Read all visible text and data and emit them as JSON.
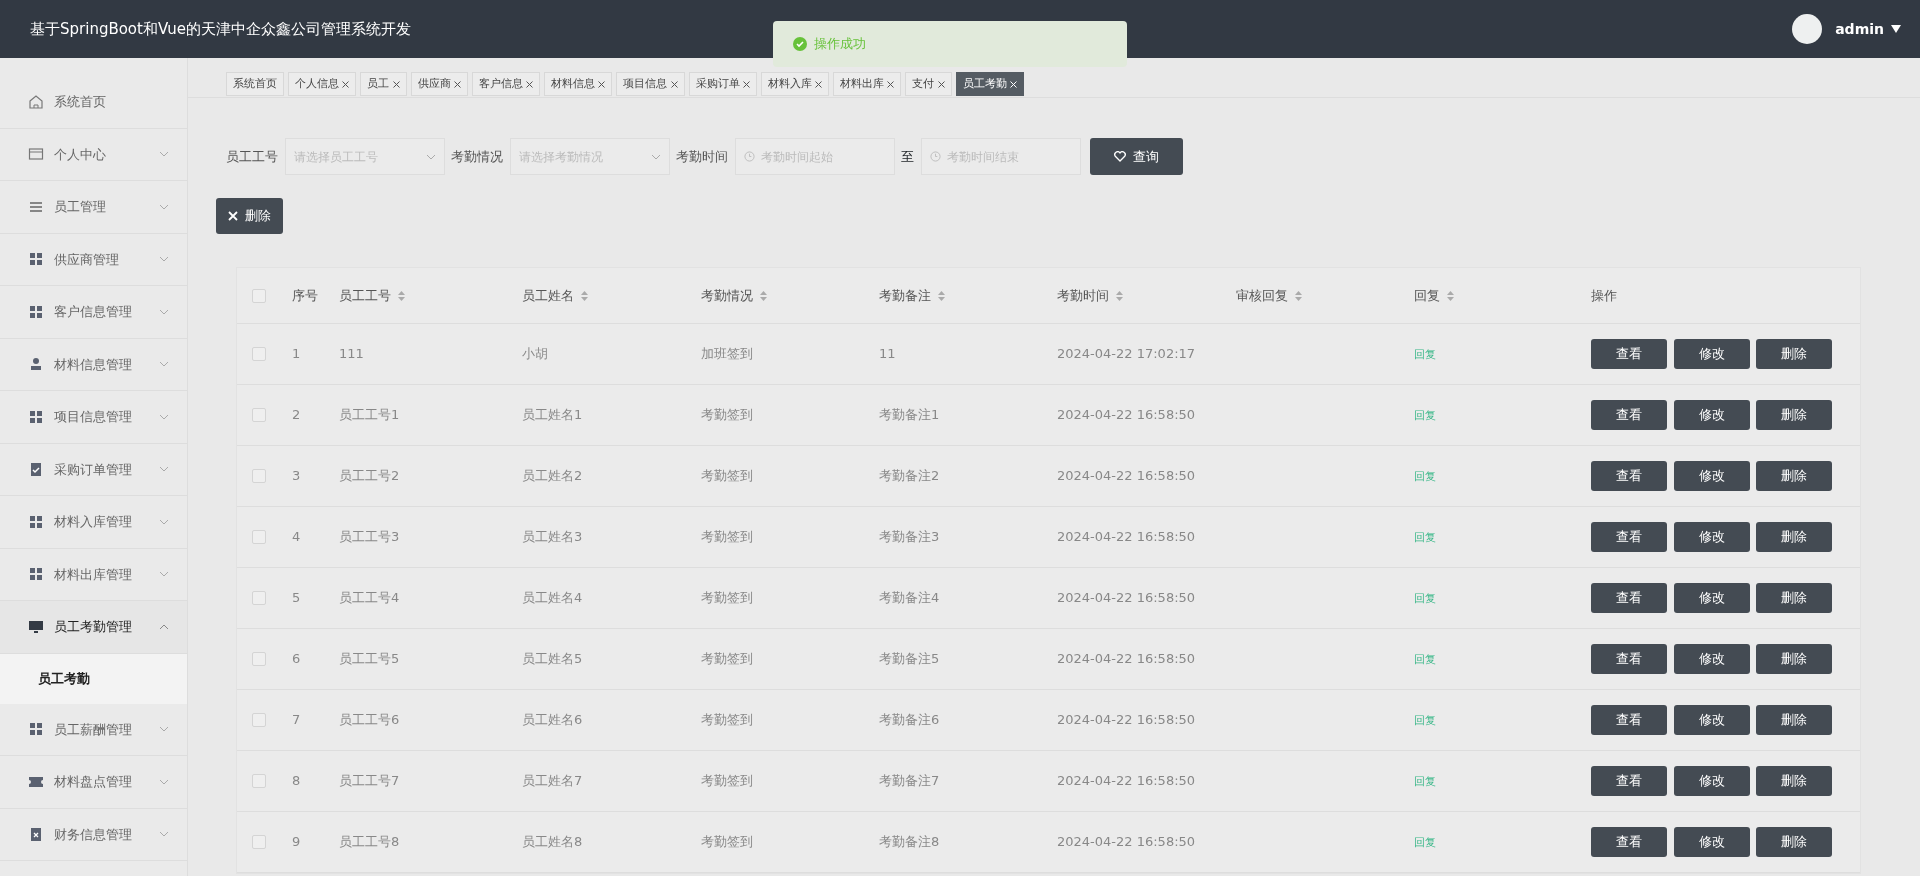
{
  "header": {
    "title": "基于SpringBoot和Vue的天津中企众鑫公司管理系统开发",
    "user": "admin"
  },
  "toast": {
    "text": "操作成功"
  },
  "tabs": [
    {
      "label": "系统首页",
      "closable": false,
      "selected": false
    },
    {
      "label": "个人信息",
      "closable": true,
      "selected": false
    },
    {
      "label": "员工",
      "closable": true,
      "selected": false
    },
    {
      "label": "供应商",
      "closable": true,
      "selected": false
    },
    {
      "label": "客户信息",
      "closable": true,
      "selected": false
    },
    {
      "label": "材料信息",
      "closable": true,
      "selected": false
    },
    {
      "label": "项目信息",
      "closable": true,
      "selected": false
    },
    {
      "label": "采购订单",
      "closable": true,
      "selected": false
    },
    {
      "label": "材料入库",
      "closable": true,
      "selected": false
    },
    {
      "label": "材料出库",
      "closable": true,
      "selected": false
    },
    {
      "label": "支付",
      "closable": true,
      "selected": false
    },
    {
      "label": "员工考勤",
      "closable": true,
      "selected": true
    }
  ],
  "sidebar": {
    "items": [
      {
        "label": "系统首页",
        "kind": "home",
        "expandable": false,
        "expanded": false
      },
      {
        "label": "个人中心",
        "kind": "wallet",
        "expandable": true,
        "expanded": false
      },
      {
        "label": "员工管理",
        "kind": "list",
        "expandable": true,
        "expanded": false
      },
      {
        "label": "供应商管理",
        "kind": "grid",
        "expandable": true,
        "expanded": false
      },
      {
        "label": "客户信息管理",
        "kind": "grid",
        "expandable": true,
        "expanded": false
      },
      {
        "label": "材料信息管理",
        "kind": "user",
        "expandable": true,
        "expanded": false
      },
      {
        "label": "项目信息管理",
        "kind": "grid",
        "expandable": true,
        "expanded": false
      },
      {
        "label": "采购订单管理",
        "kind": "check",
        "expandable": true,
        "expanded": false
      },
      {
        "label": "材料入库管理",
        "kind": "grid",
        "expandable": true,
        "expanded": false
      },
      {
        "label": "材料出库管理",
        "kind": "grid",
        "expandable": true,
        "expanded": false
      },
      {
        "label": "员工考勤管理",
        "kind": "monitor",
        "expandable": true,
        "expanded": true,
        "children": [
          {
            "label": "员工考勤",
            "selected": true
          }
        ]
      },
      {
        "label": "员工薪酬管理",
        "kind": "grid",
        "expandable": true,
        "expanded": false
      },
      {
        "label": "材料盘点管理",
        "kind": "ticket",
        "expandable": true,
        "expanded": false
      },
      {
        "label": "财务信息管理",
        "kind": "cross",
        "expandable": true,
        "expanded": false
      }
    ]
  },
  "search": {
    "fields": [
      {
        "label": "员工工号",
        "kind": "select",
        "placeholder": "请选择员工工号"
      },
      {
        "label": "考勤情况",
        "kind": "select",
        "placeholder": "请选择考勤情况"
      },
      {
        "label": "考勤时间",
        "kind": "date",
        "placeholder": "考勤时间起始"
      },
      {
        "label": "至",
        "kind": "date",
        "placeholder": "考勤时间结束"
      }
    ],
    "button": "查询"
  },
  "delete_button": "删除",
  "table": {
    "select_all_checked": false,
    "columns": [
      {
        "label": "序号",
        "sortable": false
      },
      {
        "label": "员工工号",
        "sortable": true
      },
      {
        "label": "员工姓名",
        "sortable": true
      },
      {
        "label": "考勤情况",
        "sortable": true
      },
      {
        "label": "考勤备注",
        "sortable": true
      },
      {
        "label": "考勤时间",
        "sortable": true
      },
      {
        "label": "审核回复",
        "sortable": true
      },
      {
        "label": "回复",
        "sortable": true
      },
      {
        "label": "操作",
        "sortable": false
      }
    ],
    "rows": [
      {
        "checked": false,
        "cells": [
          "1",
          "111",
          "小胡",
          "加班签到",
          "11",
          "2024-04-22 17:02:17",
          ""
        ],
        "reply": "回复",
        "actions": [
          "查看",
          "修改",
          "删除"
        ]
      },
      {
        "checked": false,
        "cells": [
          "2",
          "员工工号1",
          "员工姓名1",
          "考勤签到",
          "考勤备注1",
          "2024-04-22 16:58:50",
          ""
        ],
        "reply": "回复",
        "actions": [
          "查看",
          "修改",
          "删除"
        ]
      },
      {
        "checked": false,
        "cells": [
          "3",
          "员工工号2",
          "员工姓名2",
          "考勤签到",
          "考勤备注2",
          "2024-04-22 16:58:50",
          ""
        ],
        "reply": "回复",
        "actions": [
          "查看",
          "修改",
          "删除"
        ]
      },
      {
        "checked": false,
        "cells": [
          "4",
          "员工工号3",
          "员工姓名3",
          "考勤签到",
          "考勤备注3",
          "2024-04-22 16:58:50",
          ""
        ],
        "reply": "回复",
        "actions": [
          "查看",
          "修改",
          "删除"
        ]
      },
      {
        "checked": false,
        "cells": [
          "5",
          "员工工号4",
          "员工姓名4",
          "考勤签到",
          "考勤备注4",
          "2024-04-22 16:58:50",
          ""
        ],
        "reply": "回复",
        "actions": [
          "查看",
          "修改",
          "删除"
        ]
      },
      {
        "checked": false,
        "cells": [
          "6",
          "员工工号5",
          "员工姓名5",
          "考勤签到",
          "考勤备注5",
          "2024-04-22 16:58:50",
          ""
        ],
        "reply": "回复",
        "actions": [
          "查看",
          "修改",
          "删除"
        ]
      },
      {
        "checked": false,
        "cells": [
          "7",
          "员工工号6",
          "员工姓名6",
          "考勤签到",
          "考勤备注6",
          "2024-04-22 16:58:50",
          ""
        ],
        "reply": "回复",
        "actions": [
          "查看",
          "修改",
          "删除"
        ]
      },
      {
        "checked": false,
        "cells": [
          "8",
          "员工工号7",
          "员工姓名7",
          "考勤签到",
          "考勤备注7",
          "2024-04-22 16:58:50",
          ""
        ],
        "reply": "回复",
        "actions": [
          "查看",
          "修改",
          "删除"
        ]
      },
      {
        "checked": false,
        "cells": [
          "9",
          "员工工号8",
          "员工姓名8",
          "考勤签到",
          "考勤备注8",
          "2024-04-22 16:58:50",
          ""
        ],
        "reply": "回复",
        "actions": [
          "查看",
          "修改",
          "删除"
        ]
      }
    ]
  }
}
